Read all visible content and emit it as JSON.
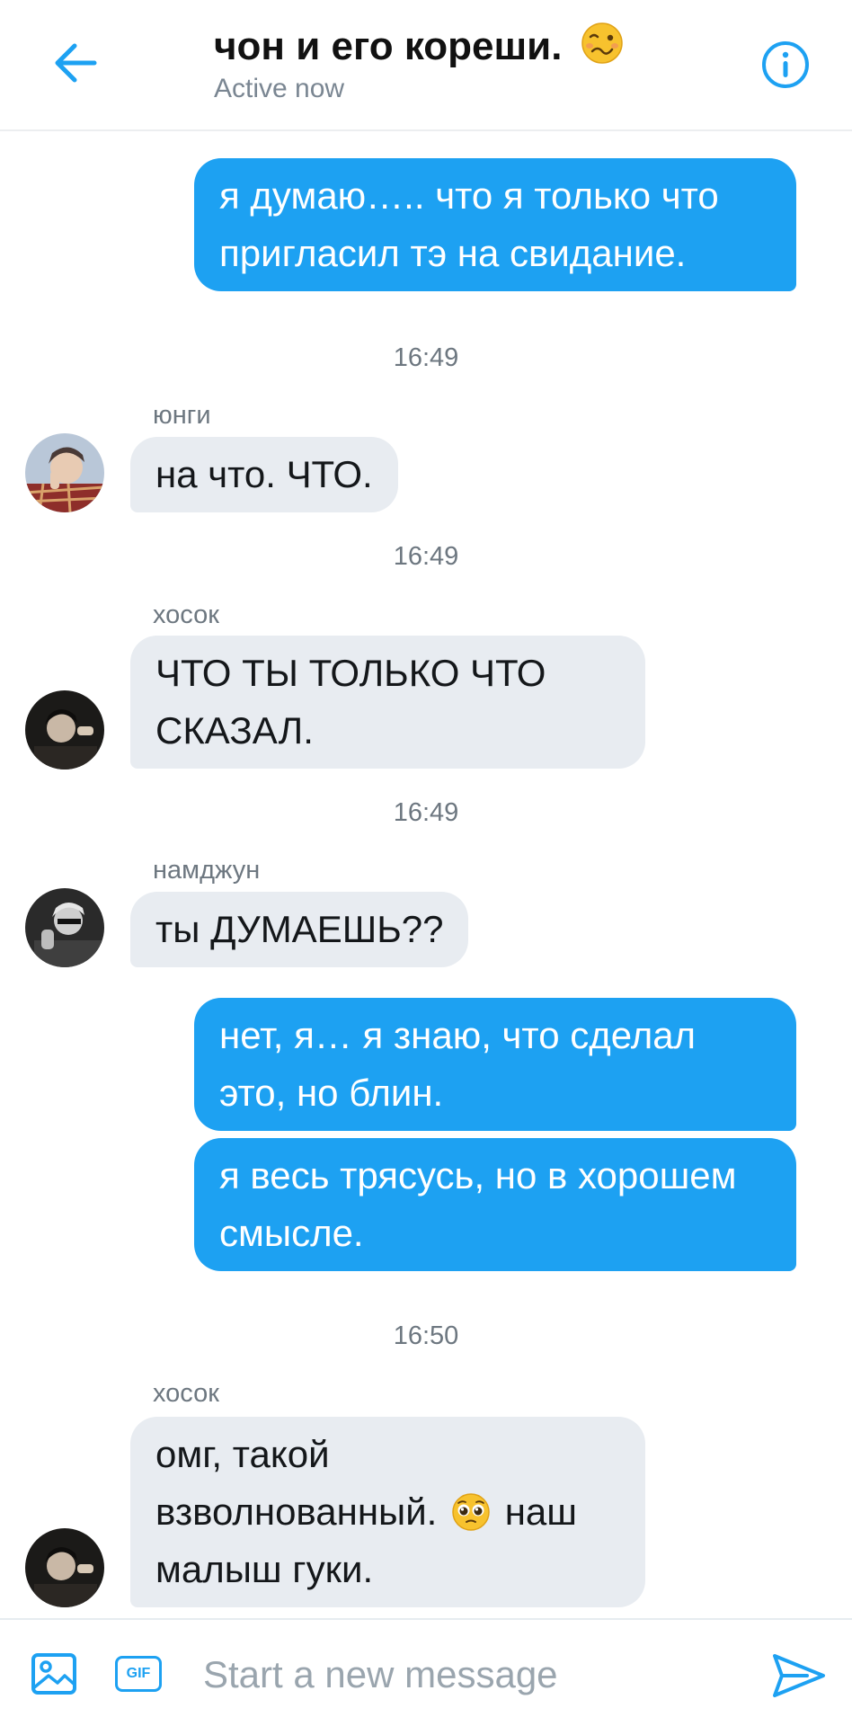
{
  "header": {
    "title": "чон и его кореши.",
    "title_emoji": "woozy-face-emoji",
    "status": "Active now",
    "back_icon": "back-arrow-icon",
    "info_icon": "info-icon"
  },
  "colors": {
    "accent": "#1da1f2",
    "incoming_bubble": "#e8ecf1",
    "muted_text": "#6d7780"
  },
  "messages": [
    {
      "type": "outgoing",
      "lines": [
        "я думаю….. что я только что",
        "пригласил тэ на свидание."
      ]
    },
    {
      "type": "timestamp",
      "text": "16:49"
    },
    {
      "type": "incoming",
      "sender": "юнги",
      "lines": [
        "на что. ЧТО."
      ]
    },
    {
      "type": "timestamp",
      "text": "16:49"
    },
    {
      "type": "incoming",
      "sender": "хосок",
      "lines": [
        "ЧТО ТЫ ТОЛЬКО ЧТО",
        "СКАЗАЛ."
      ]
    },
    {
      "type": "timestamp",
      "text": "16:49"
    },
    {
      "type": "incoming",
      "sender": "намджун",
      "lines": [
        "ты ДУМАЕШЬ??"
      ]
    },
    {
      "type": "outgoing",
      "lines": [
        "нет, я… я знаю, что сделал",
        "это, но блин."
      ]
    },
    {
      "type": "outgoing",
      "lines": [
        "я весь трясусь, но в хорошем",
        "смысле."
      ]
    },
    {
      "type": "timestamp",
      "text": "16:50"
    },
    {
      "type": "incoming",
      "sender": "хосок",
      "lines": [
        "омг, такой",
        "взволнованный.",
        "наш",
        "малыш гуки."
      ],
      "emoji": "pleading-face-emoji"
    }
  ],
  "composer": {
    "placeholder": "Start a new message",
    "gif_label": "GIF",
    "media_icon": "image-icon",
    "send_icon": "send-icon"
  }
}
